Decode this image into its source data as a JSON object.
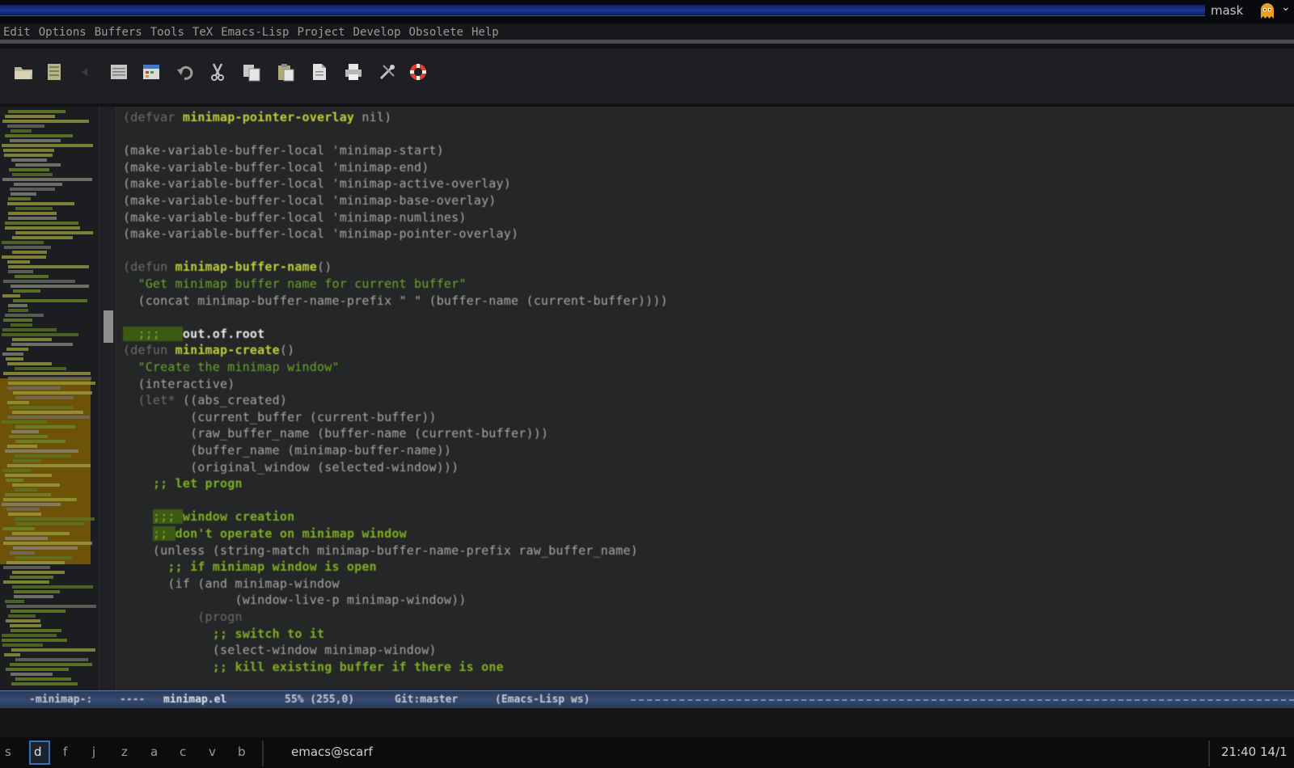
{
  "titlebar": {
    "label": "mask",
    "chevron": "⌄",
    "app_icon": "pacman-ghost-icon"
  },
  "menu": [
    "Edit",
    "Options",
    "Buffers",
    "Tools",
    "TeX",
    "Emacs-Lisp",
    "Project",
    "Develop",
    "Obsolete",
    "Help"
  ],
  "toolbar": {
    "buttons": [
      "open-folder-icon",
      "save-file-icon",
      "back-icon",
      "list-icon",
      "calendar-icon",
      "undo-icon",
      "cut-icon",
      "copy-icon",
      "paste-icon",
      "new-document-icon",
      "print-icon",
      "tools-icon",
      "help-lifebuoy-icon"
    ]
  },
  "code": [
    [
      [
        "(defvar ",
        "kw"
      ],
      [
        "minimap-pointer-overlay",
        "fn"
      ],
      [
        " nil)",
        "txt"
      ]
    ],
    [],
    [
      [
        "(make-variable-buffer-local 'minimap-start)",
        "txt"
      ]
    ],
    [
      [
        "(make-variable-buffer-local 'minimap-end)",
        "txt"
      ]
    ],
    [
      [
        "(make-variable-buffer-local 'minimap-active-overlay)",
        "txt"
      ]
    ],
    [
      [
        "(make-variable-buffer-local 'minimap-base-overlay)",
        "txt"
      ]
    ],
    [
      [
        "(make-variable-buffer-local 'minimap-numlines)",
        "txt"
      ]
    ],
    [
      [
        "(make-variable-buffer-local 'minimap-pointer-overlay)",
        "txt"
      ]
    ],
    [],
    [
      [
        "(defun ",
        "kw"
      ],
      [
        "minimap-buffer-name",
        "fn"
      ],
      [
        "()",
        "txt"
      ]
    ],
    [
      [
        "  \"Get minimap buffer name for current buffer\"",
        "str"
      ]
    ],
    [
      [
        "  (concat minimap-buffer-name-prefix \" \" (buffer-name (current-buffer))))",
        "txt"
      ]
    ],
    [],
    [
      [
        "  ;;;",
        "mark"
      ],
      [
        "   ",
        "mark"
      ],
      [
        "out.of.root",
        "pt"
      ]
    ],
    [
      [
        "(defun ",
        "kw"
      ],
      [
        "minimap-create",
        "fn"
      ],
      [
        "()",
        "txt"
      ]
    ],
    [
      [
        "  \"Create the minimap window\"",
        "str"
      ]
    ],
    [
      [
        "  (interactive)",
        "txt"
      ]
    ],
    [
      [
        "  (let* ",
        "kw"
      ],
      [
        "((abs_created)",
        "txt"
      ]
    ],
    [
      [
        "         (current_buffer (current-buffer))",
        "txt"
      ]
    ],
    [
      [
        "         (raw_buffer_name (buffer-name (current-buffer)))",
        "txt"
      ]
    ],
    [
      [
        "         (buffer_name (minimap-buffer-name))",
        "txt"
      ]
    ],
    [
      [
        "         (original_window (selected-window)))",
        "txt"
      ]
    ],
    [
      [
        "    ",
        "txt"
      ],
      [
        ";; let progn",
        "com"
      ]
    ],
    [],
    [
      [
        "    ",
        "txt"
      ],
      [
        ";;; ",
        "mark"
      ],
      [
        "window creation",
        "com"
      ]
    ],
    [
      [
        "    ",
        "txt"
      ],
      [
        ";; ",
        "mark"
      ],
      [
        "don't operate on minimap window",
        "com"
      ]
    ],
    [
      [
        "    (unless (string-match minimap-buffer-name-prefix raw_buffer_name)",
        "txt"
      ]
    ],
    [
      [
        "      ",
        "txt"
      ],
      [
        ";; if minimap window is open",
        "com"
      ]
    ],
    [
      [
        "      (if (and minimap-window",
        "txt"
      ]
    ],
    [
      [
        "               (window-live-p minimap-window))",
        "txt"
      ]
    ],
    [
      [
        "          (progn",
        "kw"
      ]
    ],
    [
      [
        "            ",
        "txt"
      ],
      [
        ";; switch to it",
        "com"
      ]
    ],
    [
      [
        "            (select-window minimap-window)",
        "txt"
      ]
    ],
    [
      [
        "            ",
        "txt"
      ],
      [
        ";; kill existing buffer if there is one",
        "com"
      ]
    ]
  ],
  "modeline": {
    "encoding": "-minimap-:",
    "dashes": "----",
    "buffer": "minimap.el",
    "position": "55% (255,0)",
    "git": "Git:master",
    "mode": "(Emacs-Lisp ws)"
  },
  "taskbar": {
    "workspaces": [
      "s",
      "d",
      "f",
      "j",
      "z",
      "a",
      "c",
      "v",
      "b"
    ],
    "active_workspace": "d",
    "window_title": "emacs@scarf",
    "clock": "21:40 14/1"
  }
}
